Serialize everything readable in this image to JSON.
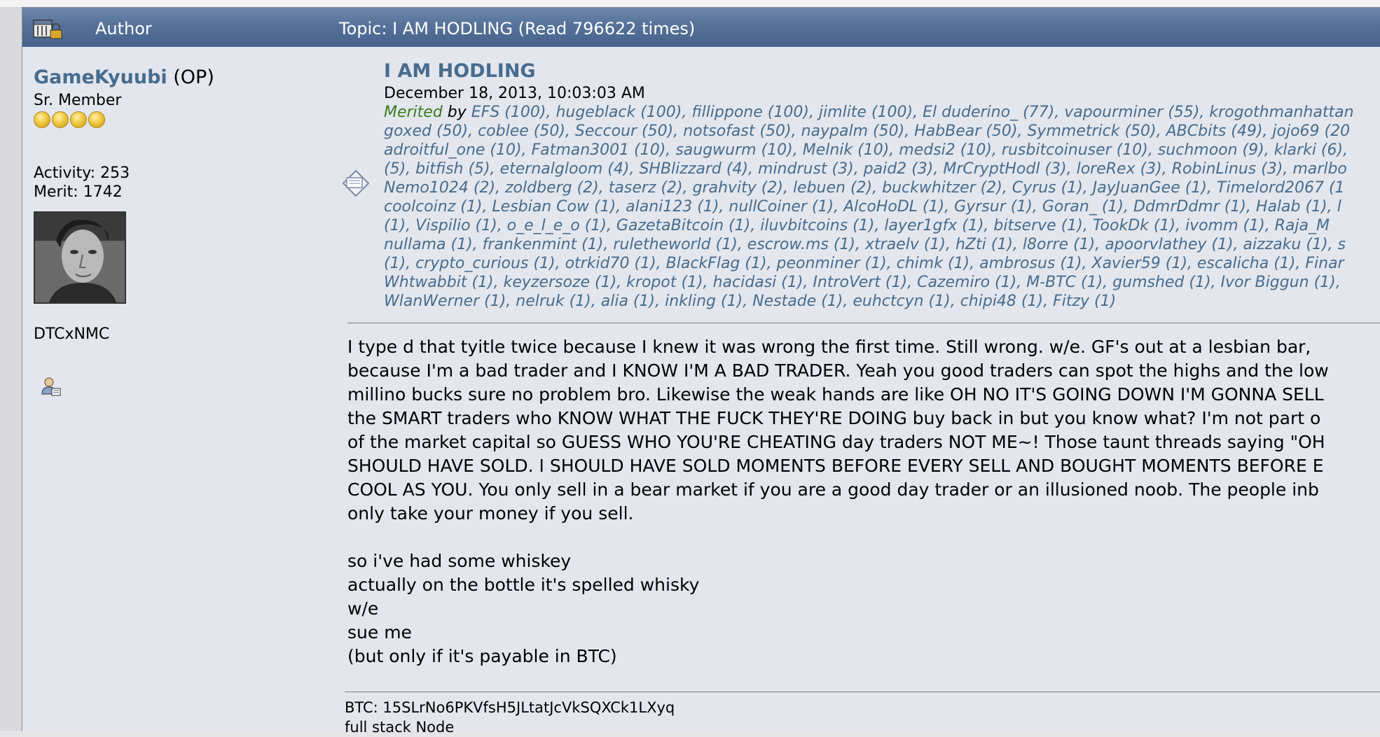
{
  "header": {
    "author_label": "Author",
    "topic_label": "Topic: I AM HODLING  (Read 796622 times)"
  },
  "poster": {
    "username": "GameKyuubi",
    "op_tag": "(OP)",
    "rank": "Sr. Member",
    "star_count": 4,
    "activity": "Activity: 253",
    "merit": "Merit: 1742",
    "signature_line": "DTCxNMC"
  },
  "post": {
    "title": "I AM HODLING",
    "date": "December 18, 2013, 10:03:03 AM",
    "merited_label": "Merited",
    "by_label": " by ",
    "merit_lines": [
      "EFS (100), hugeblack (100), fillippone (100), jimlite (100), El duderino_ (77), vapourminer (55), krogothmanhattan",
      "goxed (50), coblee (50), Seccour (50), notsofast (50), naypalm (50), HabBear (50), Symmetrick (50), ABCbits (49), jojo69 (20",
      "adroitful_one (10), Fatman3001 (10), saugwurm (10), Melnik (10), medsi2 (10), rusbitcoinuser (10), suchmoon (9), klarki (6),",
      "(5), bitfish (5), eternalgloom (4), SHBlizzard (4), mindrust (3), paid2 (3), MrCryptHodl (3), loreRex (3), RobinLinus (3), marlbo",
      "Nemo1024 (2), zoldberg (2), taserz (2), grahvity (2), lebuen (2), buckwhitzer (2), Cyrus (1), JayJuanGee (1), Timelord2067 (1",
      "coolcoinz (1), Lesbian Cow (1), alani123 (1), nullCoiner (1), AlcoHoDL (1), Gyrsur (1), Goran_ (1), DdmrDdmr (1), Halab (1), l",
      "(1), Vispilio (1), o_e_l_e_o (1), GazetaBitcoin (1), iluvbitcoins (1), layer1gfx (1), bitserve (1), TookDk (1), ivomm (1), Raja_M",
      "nullama (1), frankenmint (1), ruletheworld (1), escrow.ms (1), xtraelv (1), hZti (1), l8orre (1), apoorvlathey (1), aizzaku (1), s",
      "(1), crypto_curious (1), otrkid70 (1), BlackFlag (1), peonminer (1), chimk (1), ambrosus (1), Xavier59 (1), escalicha (1), Finar",
      "Whtwabbit (1), keyzersoze (1), kropot (1), hacidasi (1), IntroVert (1), Cazemiro (1), M-BTC (1), gumshed (1), Ivor Biggun (1),",
      "WlanWerner (1), nelruk (1), alia (1), inkling (1), Nestade (1), euhctcyn (1), chipi48 (1), Fitzy (1)"
    ],
    "body_lines": [
      "I type d that tyitle twice because I knew it was wrong the first time.  Still wrong.  w/e.  GF's out at a lesbian bar,",
      "because I'm a bad trader and I KNOW I'M A BAD TRADER.  Yeah you good traders can spot the highs and the low",
      "millino bucks sure no problem bro.  Likewise the weak hands are like OH NO IT'S GOING DOWN I'M GONNA SELL",
      "the SMART traders who KNOW WHAT THE FUCK THEY'RE DOING buy back in but you know what?  I'm not part o",
      "of the market capital so GUESS WHO YOU'RE CHEATING day traders NOT ME~!  Those taunt threads saying \"OH",
      "SHOULD HAVE SOLD.  I SHOULD HAVE SOLD MOMENTS BEFORE EVERY SELL AND BOUGHT MOMENTS BEFORE E",
      "COOL AS YOU.  You only sell in a bear market if you are a good day trader or an illusioned noob.  The people inb",
      "only take your money if you sell.",
      "",
      "so i've had some whiskey",
      "actually on the bottle it's spelled whisky",
      "w/e",
      "sue me",
      "(but only if it's payable in BTC)"
    ],
    "signature": {
      "btc": "BTC: 15SLrNo6PKVfsH5JLtatJcVkSQXCk1LXyq",
      "node": "full stack Node"
    }
  },
  "icons": {
    "header": "locked-topic-icon",
    "post": "post-message-icon",
    "profile": "profile-icon"
  },
  "colors": {
    "header_bg": "#56729a",
    "link": "#476c8e",
    "merited": "#3b7a1e",
    "post_bg": "#e3e6ed"
  }
}
